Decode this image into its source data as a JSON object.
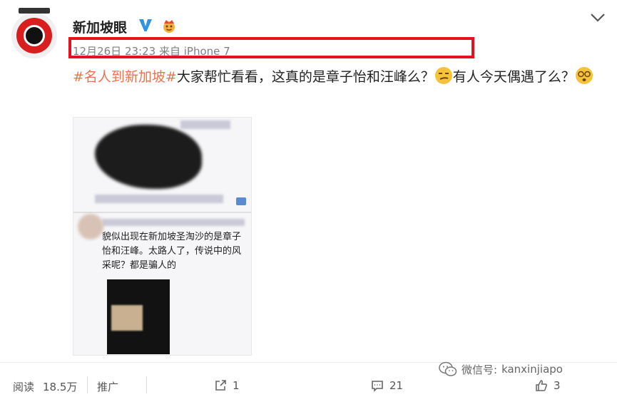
{
  "author": {
    "name": "新加坡眼",
    "avatar_alt": "新加坡眼"
  },
  "meta": {
    "timestamp": "12月26日 23:23",
    "source_prefix": "来自",
    "source": "iPhone 7"
  },
  "post": {
    "hashtag": "#名人到新加坡#",
    "text_part1": "大家帮忙看看，这真的是章子怡和汪峰么？",
    "text_part2": "有人今天偶遇了么？"
  },
  "image_card": {
    "chat_text": "貌似出现在新加坡圣淘沙的是章子怡和汪峰。太路人了，传说中的风采呢？都是骗人的"
  },
  "footer": {
    "reads_label": "阅读",
    "reads_count": "18.5万",
    "promote_label": "推广",
    "share_count": "1",
    "comment_count": "21",
    "like_count": "3"
  },
  "watermark": {
    "prefix": "微信号:",
    "handle": "kanxinjiapo"
  },
  "colors": {
    "highlight": "#e4111f",
    "hashtag": "#eb7350",
    "verified": "#2f93e8"
  },
  "icons": [
    "chevron-down-icon",
    "verified-icon",
    "crown-icon",
    "smirk-emoji",
    "dizzy-emoji",
    "share-icon",
    "comment-icon",
    "like-icon",
    "wechat-icon"
  ]
}
